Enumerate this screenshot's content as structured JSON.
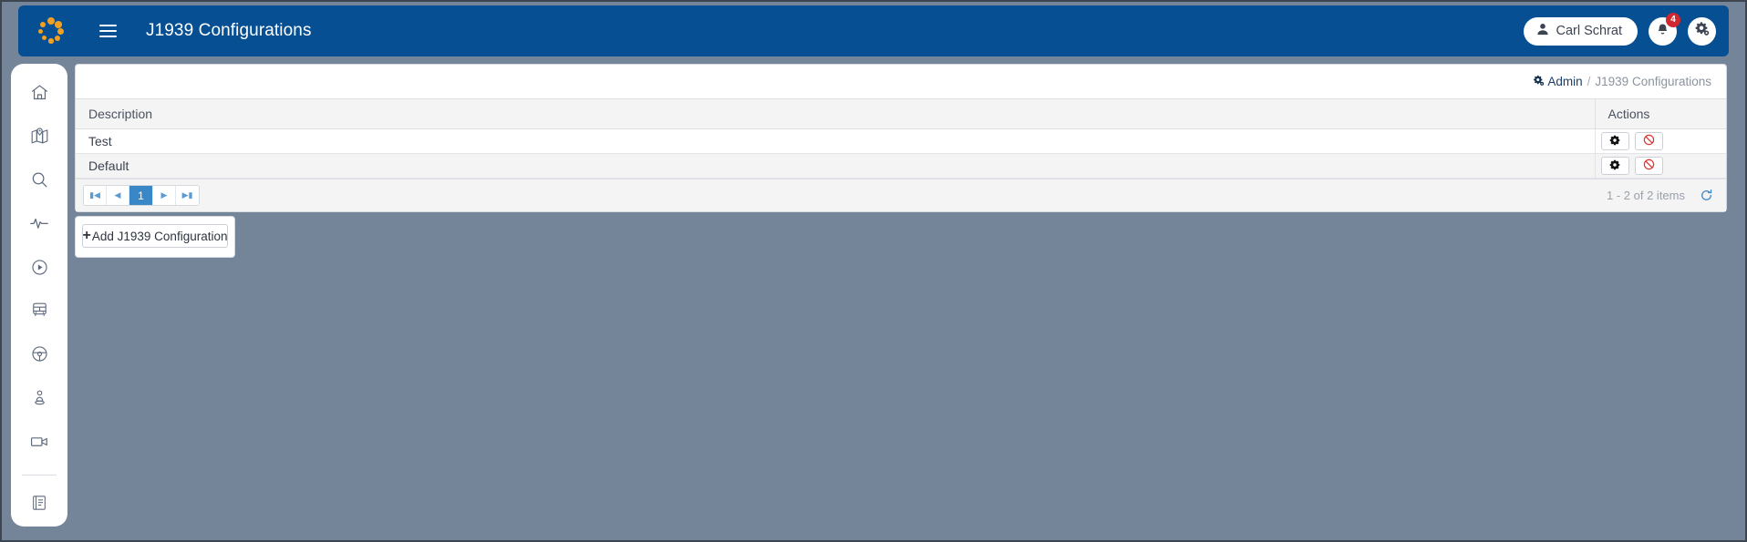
{
  "app": {
    "title": "J1939 Configurations",
    "logo_icon": "spinner-dots-logo",
    "menu_icon": "hamburger-menu-icon",
    "brand_color": "#064f93",
    "logo_color": "#f0a022",
    "page_background": "#74859a"
  },
  "topbar": {
    "user_name": "Carl Schrat",
    "user_icon": "user-icon",
    "notifications_icon": "bell-icon",
    "notifications_count": "4",
    "notifications_badge_color": "#d0282e",
    "settings_icon": "gears-icon"
  },
  "sidebar": {
    "items": [
      {
        "name": "home",
        "icon": "home-icon"
      },
      {
        "name": "map",
        "icon": "map-pin-icon"
      },
      {
        "name": "search",
        "icon": "search-icon"
      },
      {
        "name": "activity",
        "icon": "pulse-icon"
      },
      {
        "name": "playback",
        "icon": "play-circle-icon"
      },
      {
        "name": "vehicles",
        "icon": "bus-icon"
      },
      {
        "name": "driving",
        "icon": "steering-wheel-icon"
      },
      {
        "name": "drivers",
        "icon": "person-pin-icon"
      },
      {
        "name": "video",
        "icon": "video-camera-icon"
      }
    ],
    "bottom_items": [
      {
        "name": "reports",
        "icon": "book-icon"
      }
    ]
  },
  "breadcrumb": {
    "icon": "gears-icon",
    "root": "Admin",
    "separator": "/",
    "current": "J1939 Configurations"
  },
  "table": {
    "columns": [
      "Description",
      "Actions"
    ],
    "rows": [
      {
        "description": "Test"
      },
      {
        "description": "Default"
      }
    ],
    "row_actions": [
      {
        "name": "configure",
        "icon": "gear-icon"
      },
      {
        "name": "disable",
        "icon": "ban-icon",
        "color": "#e0332f"
      }
    ]
  },
  "pager": {
    "first_label": "⏮",
    "prev_label": "◀",
    "pages": [
      "1"
    ],
    "active_page": "1",
    "next_label": "▶",
    "last_label": "⏭",
    "info": "1 - 2 of 2 items",
    "refresh_icon": "refresh-icon",
    "active_color": "#3a87c8"
  },
  "add_panel": {
    "button_label": "Add J1939 Configuration",
    "button_icon": "plus-icon"
  }
}
